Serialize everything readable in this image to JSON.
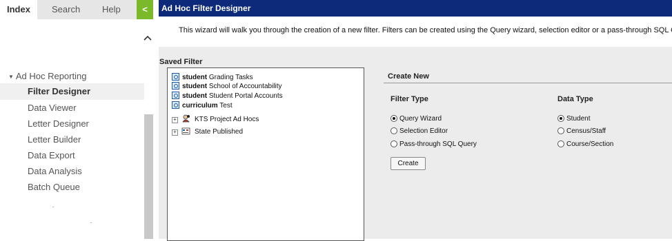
{
  "tabs": {
    "index": "Index",
    "search": "Search",
    "help": "Help",
    "collapse_glyph": "<"
  },
  "sidebar": {
    "section_label": "Ad Hoc Reporting",
    "items": [
      {
        "label": "Filter Designer",
        "selected": true
      },
      {
        "label": "Data Viewer"
      },
      {
        "label": "Letter Designer"
      },
      {
        "label": "Letter Builder"
      },
      {
        "label": "Data Export"
      },
      {
        "label": "Data Analysis"
      },
      {
        "label": "Batch Queue"
      }
    ]
  },
  "header": {
    "title": "Ad Hoc Filter Designer",
    "intro": "This wizard will walk you through the creation of a new filter. Filters can be created using the Query wizard, selection editor or a pass-through SQL Query. Ad"
  },
  "saved_filter": {
    "label": "Saved Filter",
    "items": [
      {
        "prefix": "student",
        "name": "Grading Tasks"
      },
      {
        "prefix": "student",
        "name": "School of Accountability"
      },
      {
        "prefix": "student",
        "name": "Student Portal Accounts"
      },
      {
        "prefix": "curriculum",
        "name": "Test"
      }
    ],
    "folders": [
      {
        "name": "KTS Project Ad Hocs",
        "icon": "user-group-icon"
      },
      {
        "name": "State Published",
        "icon": "state-folder-icon"
      }
    ]
  },
  "create_new": {
    "label": "Create New",
    "filter_type": {
      "heading": "Filter Type",
      "options": [
        "Query Wizard",
        "Selection Editor",
        "Pass-through SQL Query"
      ],
      "selected": "Query Wizard"
    },
    "data_type": {
      "heading": "Data Type",
      "options": [
        "Student",
        "Census/Staff",
        "Course/Section"
      ],
      "selected": "Student"
    },
    "create_button": "Create"
  },
  "colors": {
    "title_bar": "#0d2a7a",
    "collapse_button": "#7ab929",
    "panel": "#ececec",
    "selected_item": "#f0f0f0"
  }
}
